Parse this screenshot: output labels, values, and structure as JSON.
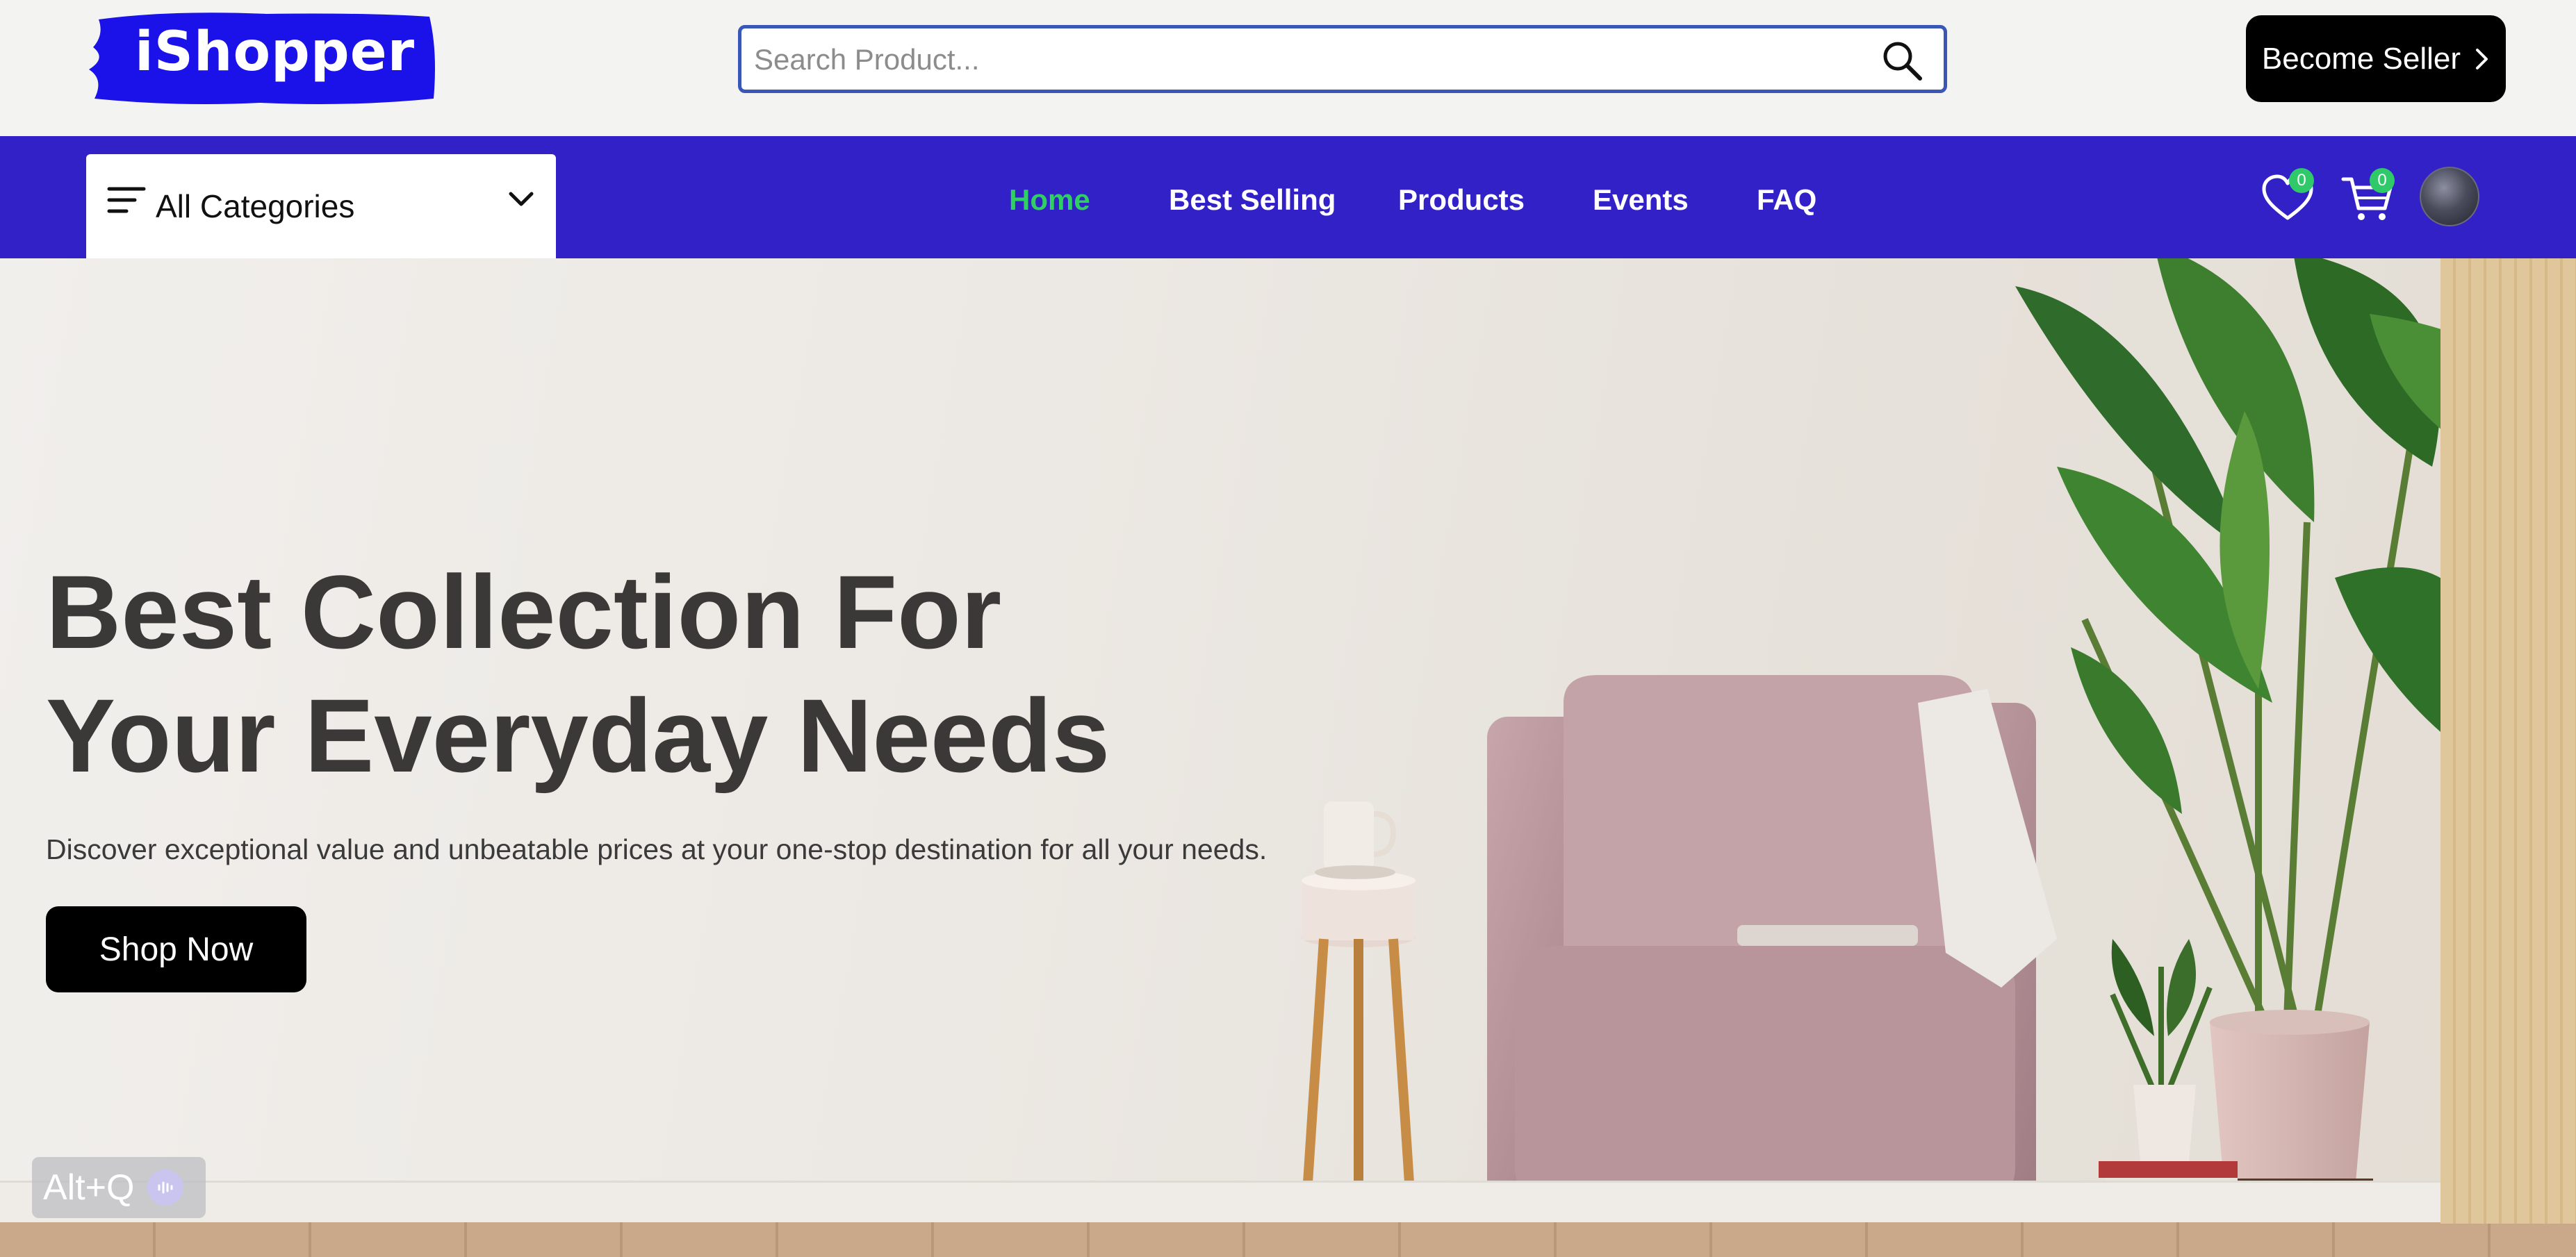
{
  "header": {
    "logo_text": "iShopper",
    "search_placeholder": "Search Product...",
    "become_seller_label": "Become Seller"
  },
  "nav": {
    "categories_label": "All Categories",
    "links": [
      {
        "label": "Home",
        "active": true
      },
      {
        "label": "Best Selling",
        "active": false
      },
      {
        "label": "Products",
        "active": false
      },
      {
        "label": "Events",
        "active": false
      },
      {
        "label": "FAQ",
        "active": false
      }
    ],
    "wishlist_count": "0",
    "cart_count": "0"
  },
  "hero": {
    "title_line1": "Best Collection For",
    "title_line2": "Your Everyday Needs",
    "subtitle": "Discover exceptional value and unbeatable prices at your one-stop destination for all your needs.",
    "cta_label": "Shop Now"
  },
  "overlay": {
    "shortcut_label": "Alt+Q"
  },
  "colors": {
    "nav_bg": "#3321c8",
    "active_link": "#2fd061",
    "logo_bg": "#1a12e8",
    "badge": "#2fc96a"
  },
  "icons": [
    "menu-icon",
    "chevron-down-icon",
    "search-icon",
    "chevron-right-icon",
    "heart-icon",
    "cart-icon",
    "microphone-icon"
  ]
}
